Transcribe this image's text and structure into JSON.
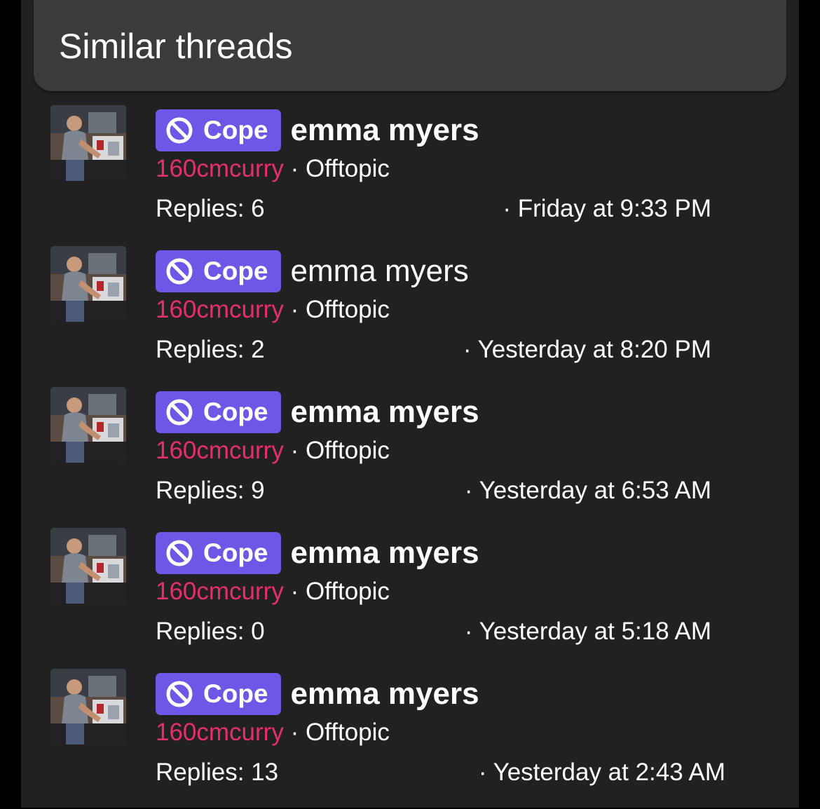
{
  "header": {
    "title": "Similar threads"
  },
  "colors": {
    "background": "#212122",
    "header_bg": "#3b3b3d",
    "prefix_bg": "#6d57e7",
    "author": "#e4306a",
    "text": "#ffffff"
  },
  "threads": [
    {
      "avatar_icon": "user-avatar",
      "prefix_icon": "ban-icon",
      "prefix": "Cope",
      "title": "emma myers",
      "title_bold": true,
      "author": "160cmcurry",
      "separator": "·",
      "forum": "Offtopic",
      "replies": "Replies: 6",
      "date": "· Friday at 9:33 PM"
    },
    {
      "avatar_icon": "user-avatar",
      "prefix_icon": "ban-icon",
      "prefix": "Cope",
      "title": "emma myers",
      "title_bold": false,
      "author": "160cmcurry",
      "separator": "·",
      "forum": "Offtopic",
      "replies": "Replies: 2",
      "date": "· Yesterday at 8:20 PM"
    },
    {
      "avatar_icon": "user-avatar",
      "prefix_icon": "ban-icon",
      "prefix": "Cope",
      "title": "emma myers",
      "title_bold": true,
      "author": "160cmcurry",
      "separator": "·",
      "forum": "Offtopic",
      "replies": "Replies: 9",
      "date": "· Yesterday at 6:53 AM"
    },
    {
      "avatar_icon": "user-avatar",
      "prefix_icon": "ban-icon",
      "prefix": "Cope",
      "title": "emma myers",
      "title_bold": true,
      "author": "160cmcurry",
      "separator": "·",
      "forum": "Offtopic",
      "replies": "Replies: 0",
      "date": "· Yesterday at 5:18 AM"
    },
    {
      "avatar_icon": "user-avatar",
      "prefix_icon": "ban-icon",
      "prefix": "Cope",
      "title": "emma myers",
      "title_bold": true,
      "author": "160cmcurry",
      "separator": "·",
      "forum": "Offtopic",
      "replies": "Replies: 13",
      "date": "· Yesterday at 2:43 AM"
    }
  ]
}
